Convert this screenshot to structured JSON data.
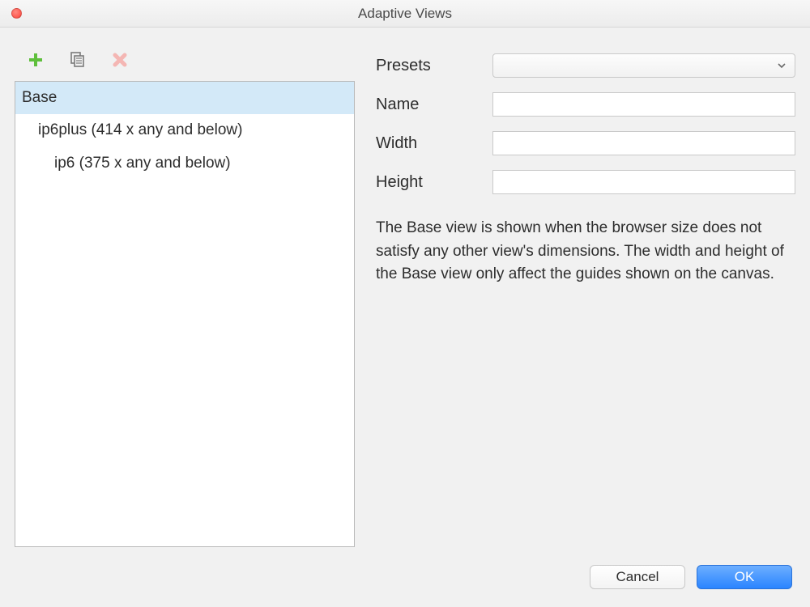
{
  "window": {
    "title": "Adaptive Views"
  },
  "toolbar": {
    "add_title": "Add",
    "copy_title": "Duplicate",
    "delete_title": "Delete"
  },
  "views": [
    {
      "label": "Base",
      "indent": 0,
      "selected": true
    },
    {
      "label": "ip6plus (414 x any and below)",
      "indent": 1,
      "selected": false
    },
    {
      "label": "ip6 (375 x any and below)",
      "indent": 2,
      "selected": false
    }
  ],
  "form": {
    "presets_label": "Presets",
    "presets_value": "",
    "name_label": "Name",
    "name_value": "",
    "width_label": "Width",
    "width_value": "",
    "height_label": "Height",
    "height_value": ""
  },
  "description": "The Base view is shown when the browser size does not satisfy any other view's dimensions. The width and height of the Base view only affect the guides shown on the canvas.",
  "footer": {
    "cancel": "Cancel",
    "ok": "OK"
  }
}
